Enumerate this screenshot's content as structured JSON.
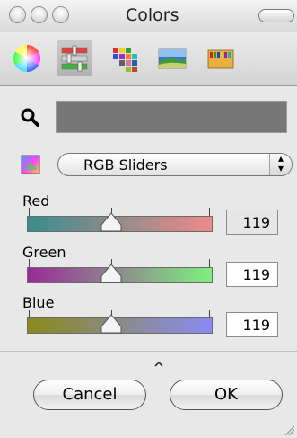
{
  "window": {
    "title": "Colors"
  },
  "modes": [
    {
      "icon": "color-wheel-icon",
      "selected": false
    },
    {
      "icon": "color-sliders-icon",
      "selected": true
    },
    {
      "icon": "color-palettes-icon",
      "selected": false
    },
    {
      "icon": "image-palettes-icon",
      "selected": false
    },
    {
      "icon": "crayons-icon",
      "selected": false
    }
  ],
  "current_color": "#777777",
  "slider_mode": {
    "selected": "RGB Sliders"
  },
  "sliders": [
    {
      "label": "Red",
      "value": "119",
      "start": "#3a8c8c",
      "end": "#f08a8a"
    },
    {
      "label": "Green",
      "value": "119",
      "start": "#9a2a9a",
      "end": "#7ff07f"
    },
    {
      "label": "Blue",
      "value": "119",
      "start": "#8a8a1a",
      "end": "#8a8af5"
    }
  ],
  "buttons": {
    "cancel": "Cancel",
    "ok": "OK"
  }
}
